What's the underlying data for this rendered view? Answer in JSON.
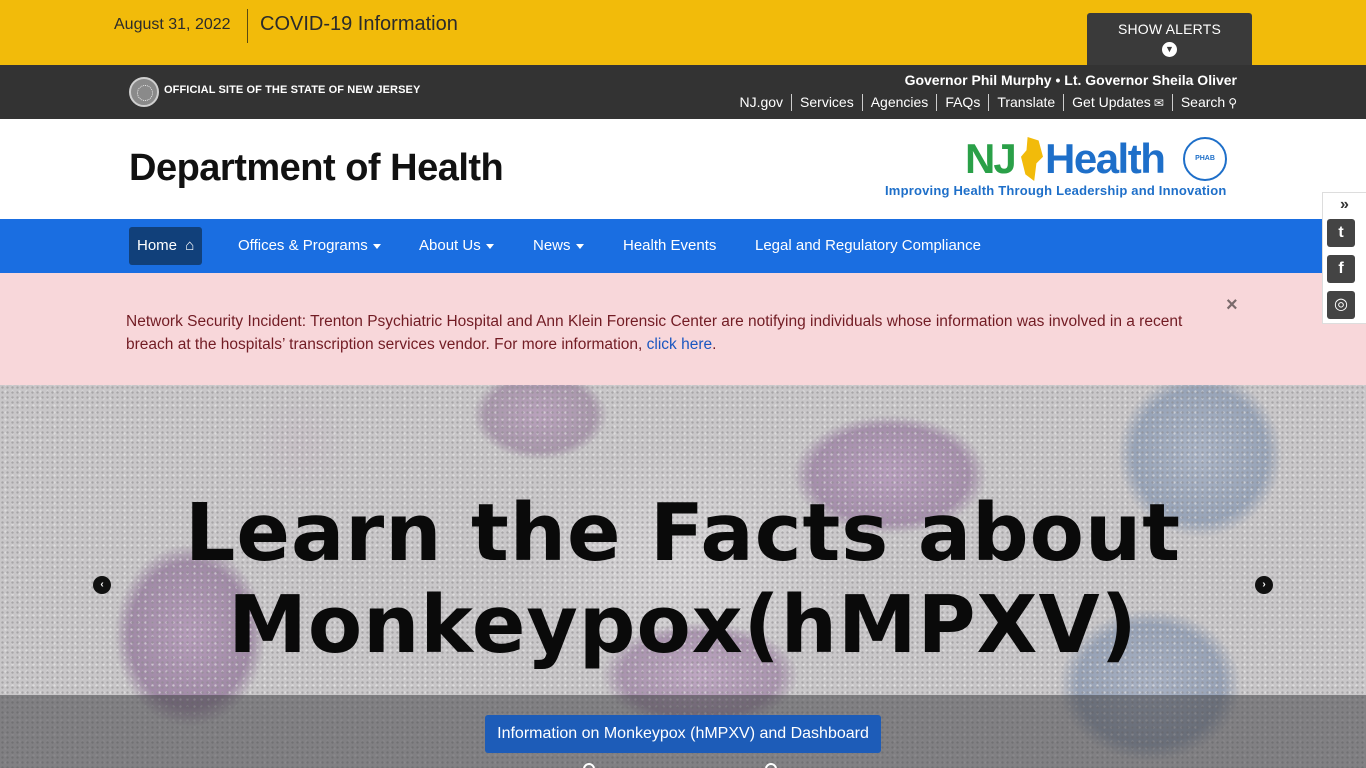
{
  "alert_bar": {
    "date": "August 31, 2022",
    "covid_link": "COVID-19 Information",
    "show_alerts": "SHOW ALERTS"
  },
  "state_bar": {
    "official_site": "OFFICIAL SITE OF THE STATE OF NEW JERSEY",
    "governor": "Governor Phil Murphy • Lt. Governor Sheila Oliver",
    "links": [
      "NJ.gov",
      "Services",
      "Agencies",
      "FAQs",
      "Translate",
      "Get Updates",
      "Search"
    ]
  },
  "header": {
    "title": "Department of Health",
    "logo": {
      "brand_nj": "NJ",
      "brand_health": "Health",
      "badge": "PHAB",
      "tagline": "Improving Health Through Leadership and Innovation"
    }
  },
  "nav": {
    "items": [
      "Home",
      "Offices & Programs",
      "About Us",
      "News",
      "Health Events",
      "Legal and Regulatory Compliance"
    ]
  },
  "incident": {
    "text": "Network Security Incident: Trenton Psychiatric Hospital and Ann Klein Forensic Center are notifying individuals whose information was involved in a recent breach at the hospitals’ transcription services vendor.  For more information, ",
    "link": "click here",
    "suffix": ".",
    "close": "×"
  },
  "social": {
    "toggle": "»",
    "twitter": "t",
    "facebook": "f",
    "instagram": "◎"
  },
  "hero": {
    "headline_line1": "Learn the Facts about",
    "headline_line2": "Monkeypox(hMPXV)",
    "button": "Information on Monkeypox (hMPXV) and Dashboard",
    "prev": "‹",
    "next": "›"
  },
  "colors": {
    "alert_bar": "#f2bb0a",
    "state_bar": "#333333",
    "nav": "#1a6ee1",
    "nav_active": "#11407a",
    "incident_bg": "#f8d7da",
    "hero_button": "#1d5cb8"
  },
  "icons": {
    "chevron": "chevron-down-icon",
    "envelope": "envelope-icon",
    "search": "search-icon",
    "home": "home-icon",
    "close": "close-icon"
  }
}
